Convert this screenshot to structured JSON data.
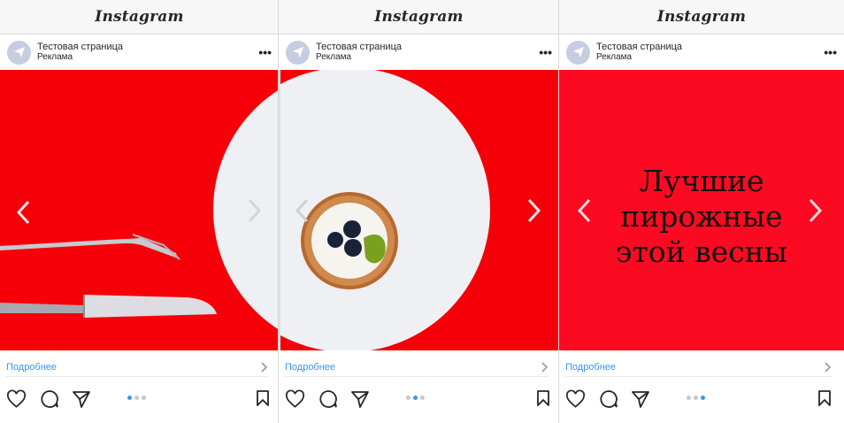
{
  "app": {
    "logo_text": "Instagram"
  },
  "post": {
    "account_name": "Тестовая страница",
    "sponsored_label": "Реклама",
    "more_label": "•••",
    "cta_label": "Подробнее"
  },
  "slides": [
    {
      "active_dot": 0
    },
    {
      "active_dot": 1
    },
    {
      "active_dot": 2,
      "caption_lines": [
        "Лучшие",
        "пирожные",
        "этой весны"
      ]
    }
  ],
  "carousel": {
    "dot_count": 3
  },
  "colors": {
    "media_background": "#f50008",
    "link_blue": "#3897f0",
    "plate_white": "#eef0f3",
    "topbar_background": "#f7f7f7"
  },
  "icons": [
    "heart-icon",
    "comment-icon",
    "share-icon",
    "bookmark-icon",
    "chevron-left-icon",
    "chevron-right-icon",
    "more-icon",
    "avatar-icon"
  ]
}
